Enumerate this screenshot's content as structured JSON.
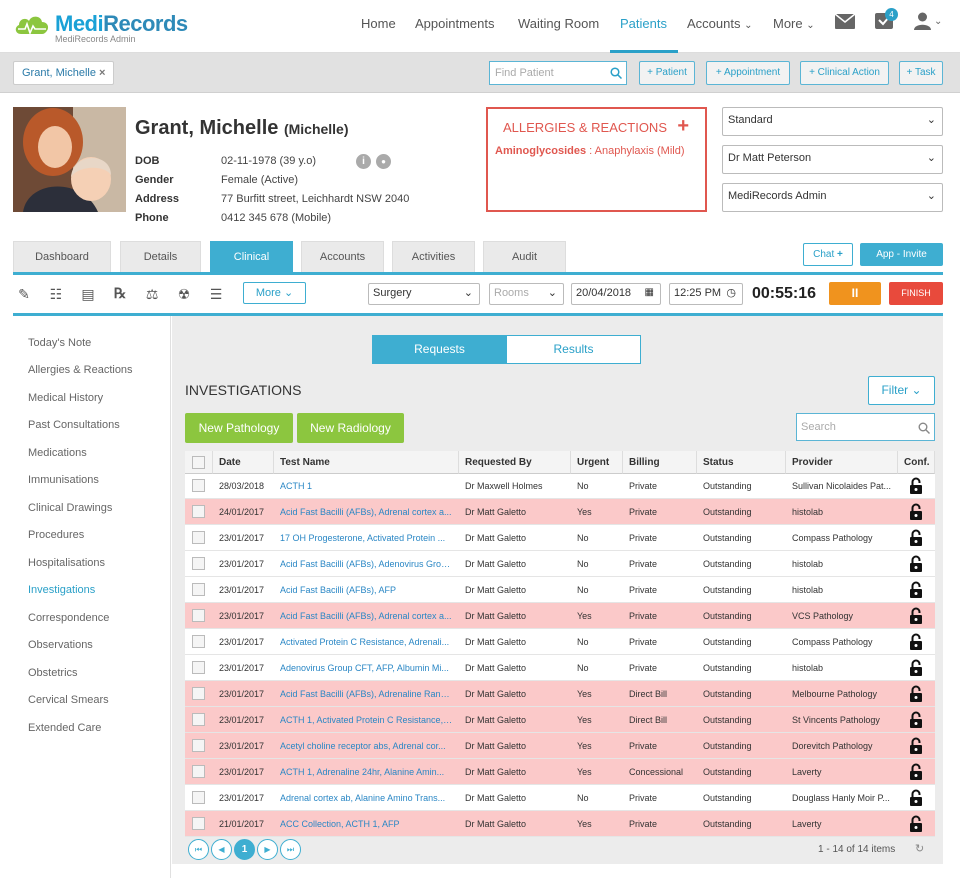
{
  "brand": {
    "name_a": "Medi",
    "name_b": "Records",
    "sub": "MediRecords Admin"
  },
  "nav": {
    "items": [
      "Home",
      "Appointments",
      "Waiting Room",
      "Patients",
      "Accounts",
      "More"
    ],
    "active": "Patients",
    "badge_count": "4"
  },
  "search": {
    "patient_chip": "Grant, Michelle",
    "find_placeholder": "Find Patient",
    "actions": [
      "+ Patient",
      "+ Appointment",
      "+ Clinical Action",
      "+ Task"
    ]
  },
  "patient": {
    "name": "Grant, Michelle",
    "preferred": "(Michelle)",
    "fields": [
      {
        "label": "DOB",
        "value": "02-11-1978 (39 y.o)"
      },
      {
        "label": "Gender",
        "value": "Female (Active)"
      },
      {
        "label": "Address",
        "value": "77 Burfitt street, Leichhardt NSW 2040"
      },
      {
        "label": "Phone",
        "value": "0412 345 678 (Mobile)"
      }
    ]
  },
  "allergies": {
    "title": "ALLERGIES & REACTIONS",
    "add": "+",
    "item_name": "Aminoglycosides",
    "item_reaction": " : Anaphylaxis (Mild)"
  },
  "selects": {
    "fee": "Standard",
    "doctor": "Dr Matt Peterson",
    "practice": "MediRecords Admin"
  },
  "tabs": [
    "Dashboard",
    "Details",
    "Clinical",
    "Accounts",
    "Activities",
    "Audit"
  ],
  "active_tab": "Clinical",
  "chat_label": "Chat",
  "app_invite_label": "App - Invite",
  "toolbar": {
    "more": "More",
    "location": "Surgery",
    "rooms_placeholder": "Rooms",
    "date": "20/04/2018",
    "time": "12:25 PM",
    "timer": "00:55:16",
    "pause": "II",
    "finish": "FINISH"
  },
  "sidenav": [
    "Today's Note",
    "Allergies & Reactions",
    "Medical History",
    "Past Consultations",
    "Medications",
    "Immunisations",
    "Clinical Drawings",
    "Procedures",
    "Hospitalisations",
    "Investigations",
    "Correspondence",
    "Observations",
    "Obstetrics",
    "Cervical Smears",
    "Extended Care"
  ],
  "sidenav_active": "Investigations",
  "investigations": {
    "segments": [
      "Requests",
      "Results"
    ],
    "title": "INVESTIGATIONS",
    "filter": "Filter",
    "new_pathology": "New Pathology",
    "new_radiology": "New Radiology",
    "search_placeholder": "Search",
    "columns": [
      "Date",
      "Test Name",
      "Requested By",
      "Urgent",
      "Billing",
      "Status",
      "Provider",
      "Conf."
    ],
    "rows": [
      {
        "date": "28/03/2018",
        "test": "ACTH 1",
        "by": "Dr Maxwell Holmes",
        "urgent": "No",
        "billing": "Private",
        "status": "Outstanding",
        "provider": "Sullivan Nicolaides Pat..."
      },
      {
        "date": "24/01/2017",
        "test": "Acid Fast Bacilli (AFBs), Adrenal cortex a...",
        "by": "Dr Matt Galetto",
        "urgent": "Yes",
        "billing": "Private",
        "status": "Outstanding",
        "provider": "histolab"
      },
      {
        "date": "23/01/2017",
        "test": "17 OH Progesterone, Activated Protein ...",
        "by": "Dr Matt Galetto",
        "urgent": "No",
        "billing": "Private",
        "status": "Outstanding",
        "provider": "Compass Pathology"
      },
      {
        "date": "23/01/2017",
        "test": "Acid Fast Bacilli (AFBs), Adenovirus Grou...",
        "by": "Dr Matt Galetto",
        "urgent": "No",
        "billing": "Private",
        "status": "Outstanding",
        "provider": "histolab"
      },
      {
        "date": "23/01/2017",
        "test": "Acid Fast Bacilli (AFBs), AFP",
        "by": "Dr Matt Galetto",
        "urgent": "No",
        "billing": "Private",
        "status": "Outstanding",
        "provider": "histolab"
      },
      {
        "date": "23/01/2017",
        "test": "Acid Fast Bacilli (AFBs), Adrenal cortex a...",
        "by": "Dr Matt Galetto",
        "urgent": "Yes",
        "billing": "Private",
        "status": "Outstanding",
        "provider": "VCS Pathology"
      },
      {
        "date": "23/01/2017",
        "test": "Activated Protein C Resistance, Adrenali...",
        "by": "Dr Matt Galetto",
        "urgent": "No",
        "billing": "Private",
        "status": "Outstanding",
        "provider": "Compass Pathology"
      },
      {
        "date": "23/01/2017",
        "test": "Adenovirus Group CFT, AFP, Albumin Mi...",
        "by": "Dr Matt Galetto",
        "urgent": "No",
        "billing": "Private",
        "status": "Outstanding",
        "provider": "histolab"
      },
      {
        "date": "23/01/2017",
        "test": "Acid Fast Bacilli (AFBs), Adrenaline Rand...",
        "by": "Dr Matt Galetto",
        "urgent": "Yes",
        "billing": "Direct Bill",
        "status": "Outstanding",
        "provider": "Melbourne Pathology"
      },
      {
        "date": "23/01/2017",
        "test": "ACTH 1, Activated Protein C Resistance, ...",
        "by": "Dr Matt Galetto",
        "urgent": "Yes",
        "billing": "Direct Bill",
        "status": "Outstanding",
        "provider": "St Vincents Pathology"
      },
      {
        "date": "23/01/2017",
        "test": "Acetyl choline receptor abs, Adrenal cor...",
        "by": "Dr Matt Galetto",
        "urgent": "Yes",
        "billing": "Private",
        "status": "Outstanding",
        "provider": "Dorevitch Pathology"
      },
      {
        "date": "23/01/2017",
        "test": "ACTH 1, Adrenaline 24hr, Alanine Amin...",
        "by": "Dr Matt Galetto",
        "urgent": "Yes",
        "billing": "Concessional",
        "status": "Outstanding",
        "provider": "Laverty"
      },
      {
        "date": "23/01/2017",
        "test": "Adrenal cortex ab, Alanine Amino Trans...",
        "by": "Dr Matt Galetto",
        "urgent": "No",
        "billing": "Private",
        "status": "Outstanding",
        "provider": "Douglass Hanly Moir P..."
      },
      {
        "date": "21/01/2017",
        "test": "ACC Collection, ACTH 1, AFP",
        "by": "Dr Matt Galetto",
        "urgent": "Yes",
        "billing": "Private",
        "status": "Outstanding",
        "provider": "Laverty"
      }
    ],
    "page": "1",
    "pager_info": "1 - 14 of 14 items"
  },
  "colors": {
    "accent": "#3eaed1",
    "urgent_row": "#fbc9c9",
    "allergy": "#e0574f",
    "green": "#8cc63f",
    "pause": "#f0931e",
    "finish": "#e84a3c"
  }
}
